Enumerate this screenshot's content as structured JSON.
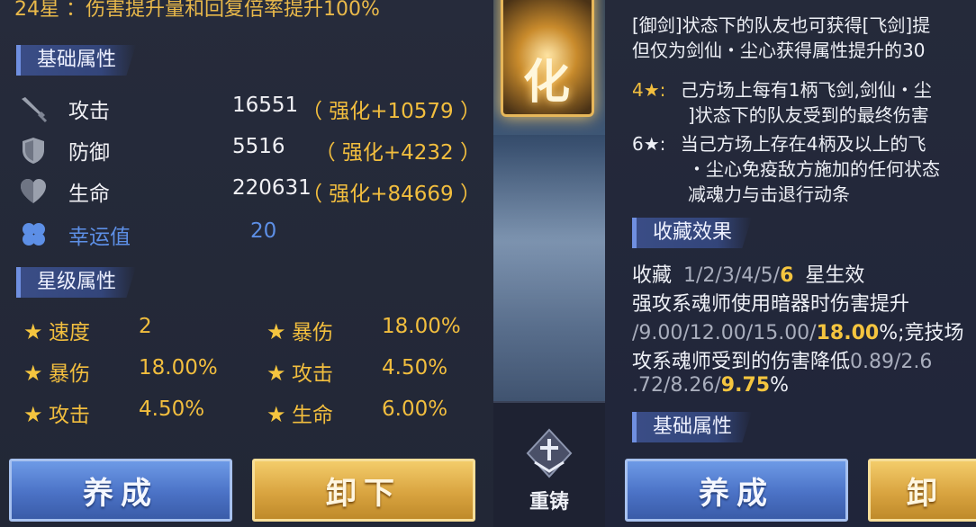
{
  "left": {
    "top_note": "24星 ：伤害提升量和回复倍率提升100%",
    "base_section": "基础属性",
    "attributes": [
      {
        "label": "攻击",
        "value": "16551",
        "bonus": "（ 强化+10579 ）",
        "icon": "sword-icon"
      },
      {
        "label": "防御",
        "value": "5516",
        "bonus": "（ 强化+4232 ）",
        "icon": "shield-icon"
      },
      {
        "label": "生命",
        "value": "220631",
        "bonus": "（ 强化+84669 ）",
        "icon": "heart-icon"
      }
    ],
    "luck": {
      "label": "幸运值",
      "value": "20",
      "icon": "clover-icon"
    },
    "star_section": "星级属性",
    "star_attributes": [
      {
        "label": "速度",
        "value": "2"
      },
      {
        "label": "暴伤",
        "value": "18.00%"
      },
      {
        "label": "暴伤",
        "value": "18.00%"
      },
      {
        "label": "攻击",
        "value": "4.50%"
      },
      {
        "label": "攻击",
        "value": "4.50%"
      },
      {
        "label": "生命",
        "value": "6.00%"
      }
    ],
    "buttons": {
      "cultivate": "养成",
      "unequip": "卸下"
    }
  },
  "center": {
    "emblem_text": "化",
    "reforge_label": "重铸",
    "reforge_icon": "reforge-icon"
  },
  "right": {
    "lines": {
      "l1": "[御剑]状态下的队友也可获得[飞剑]提",
      "l2": "但仅为剑仙・尘心获得属性提升的30",
      "l3_prefix": "4★:",
      "l3": "己方场上每有1柄飞剑,剑仙・尘",
      "l4": "]状态下的队友受到的最终伤害",
      "l5_prefix": "6★:",
      "l5": "当己方场上存在4柄及以上的飞",
      "l6": "・尘心免疫敌方施加的任何状态",
      "l7": "减魂力与击退行动条"
    },
    "collection_section": "收藏效果",
    "collection": {
      "label": "收藏",
      "levels_grey": "1/2/3/4/5/",
      "levels_bright": "6",
      "suffix": "星生效",
      "e1": "强攻系魂师使用暗器时伤害提升",
      "e2_grey": "/9.00/12.00/15.00/",
      "e2_bright": "18.00",
      "e2_tail": "%;竞技场",
      "e3": "攻系魂师受到的伤害降低",
      "e3_grey": "0.89/2.6",
      "e4_grey": ".72/8.26/",
      "e4_bright": "9.75",
      "e4_tail": "%"
    },
    "base_section": "基础属性",
    "buttons": {
      "cultivate": "养成",
      "unequip_partial": "卸"
    }
  },
  "colors": {
    "gold": "#f2be3e",
    "blue_accent": "#5d8fe6",
    "panel_bg": "#242939"
  }
}
